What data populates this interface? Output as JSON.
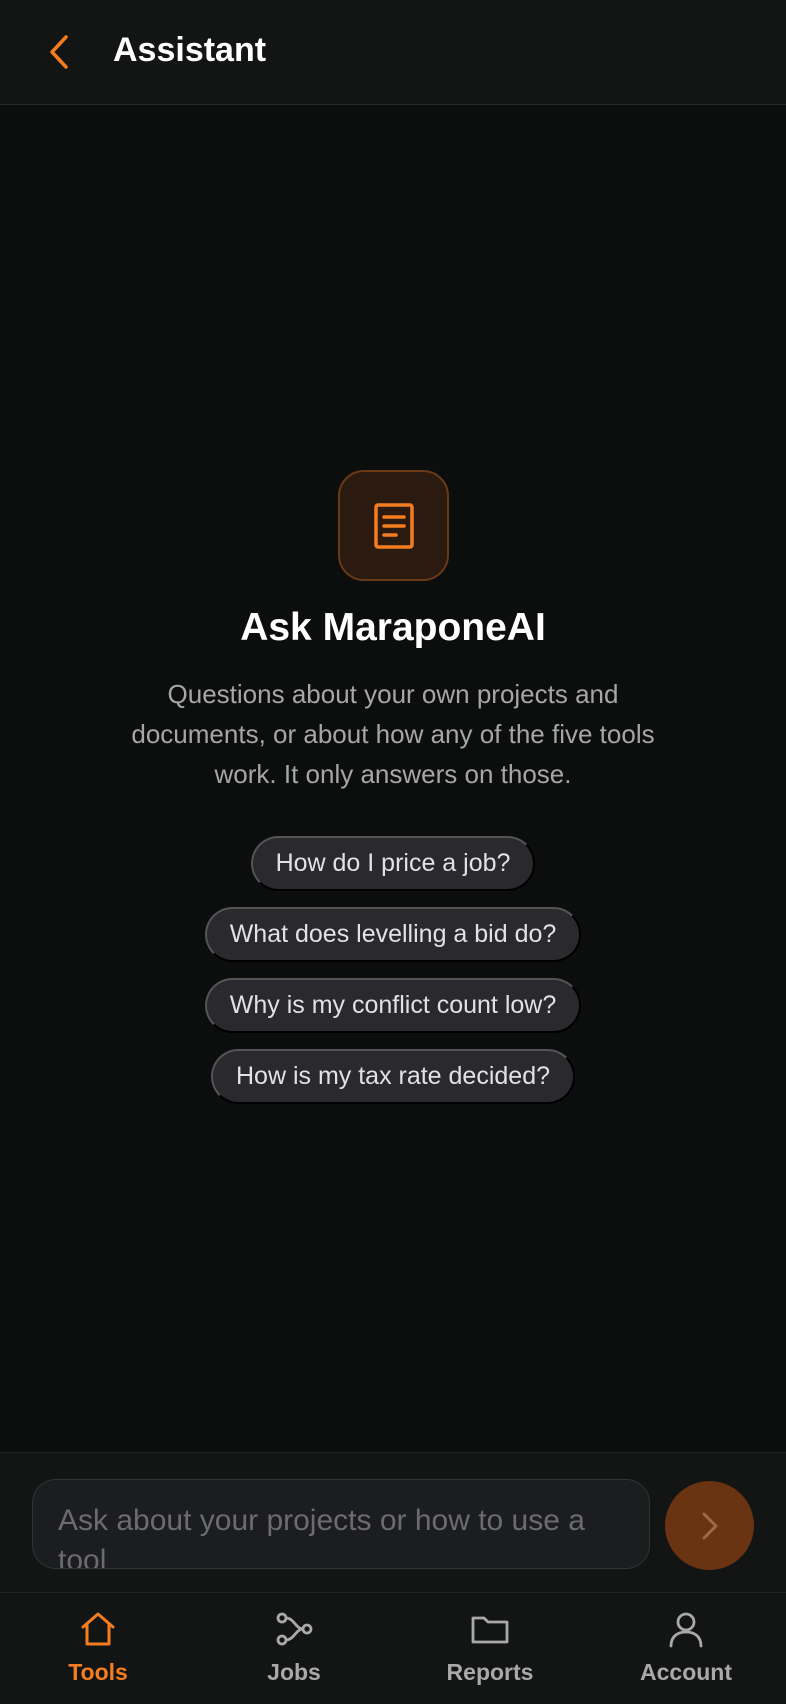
{
  "header": {
    "title": "Assistant",
    "back_icon": "chevron-left-icon"
  },
  "hero": {
    "icon": "document-icon",
    "title": "Ask MaraponeAI",
    "description": "Questions about your own projects and documents, or about how any of the five tools work. It only answers on those."
  },
  "suggestions": [
    {
      "label": "How do I price a job?"
    },
    {
      "label": "What does levelling a bid do?"
    },
    {
      "label": "Why is my conflict count low?"
    },
    {
      "label": "How is my tax rate decided?"
    }
  ],
  "composer": {
    "placeholder": "Ask about your projects or how to use a tool",
    "send_icon": "chevron-right-icon"
  },
  "tabs": [
    {
      "label": "Tools",
      "icon": "home-icon",
      "active": true
    },
    {
      "label": "Jobs",
      "icon": "share-nodes-icon",
      "active": false
    },
    {
      "label": "Reports",
      "icon": "folder-icon",
      "active": false
    },
    {
      "label": "Account",
      "icon": "person-icon",
      "active": false
    }
  ],
  "colors": {
    "accent": "#f47d20",
    "background": "#0c0d0d",
    "surface": "#131414",
    "chip": "#2a2a2e",
    "send_button": "#6a3311"
  }
}
